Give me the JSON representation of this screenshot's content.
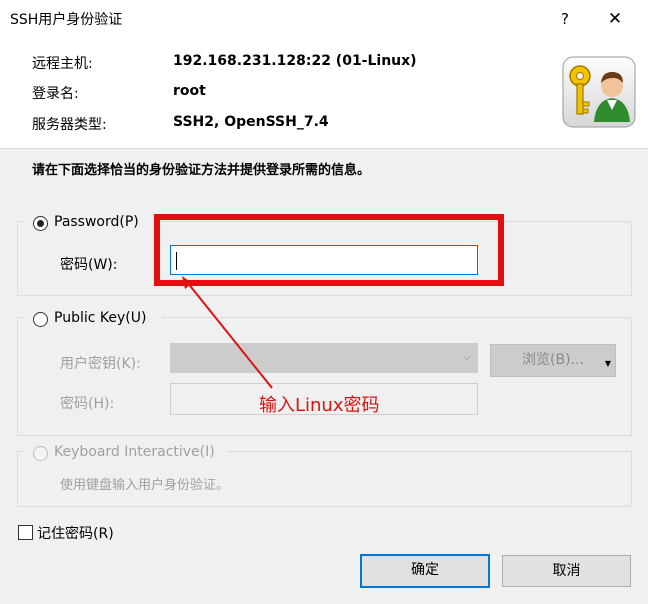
{
  "window": {
    "title": "SSH用户身份验证",
    "help_label": "?",
    "close_label": "✕"
  },
  "info": {
    "host_label": "远程主机:",
    "host_value": "192.168.231.128:22 (01-Linux)",
    "login_label": "登录名:",
    "login_value": "root",
    "server_type_label": "服务器类型:",
    "server_type_value": "SSH2, OpenSSH_7.4"
  },
  "instruction": "请在下面选择恰当的身份验证方法并提供登录所需的信息。",
  "password_section": {
    "radio_label": "Password(P)",
    "selected": true,
    "field_label": "密码(W):",
    "field_value": ""
  },
  "publickey_section": {
    "radio_label": "Public Key(U)",
    "selected": false,
    "user_key_label": "用户密钥(K):",
    "user_key_value": "",
    "browse_label": "浏览(B)...",
    "passphrase_label": "密码(H):",
    "passphrase_value": ""
  },
  "keyboard_section": {
    "radio_label": "Keyboard Interactive(I)",
    "selected": false,
    "description": "使用键盘输入用户身份验证。"
  },
  "remember": {
    "label": "记住密码(R)",
    "checked": false
  },
  "buttons": {
    "ok_label": "确定",
    "cancel_label": "取消"
  },
  "annotation": {
    "text": "输入Linux密码",
    "color": "#e01010"
  },
  "colors": {
    "focus_border": "#0078d7",
    "dialog_bg": "#f0f0f0"
  },
  "icons": {
    "help": "help-icon",
    "close": "close-icon",
    "key_user": "key-user-icon",
    "dropdown": "chevron-down-icon"
  }
}
